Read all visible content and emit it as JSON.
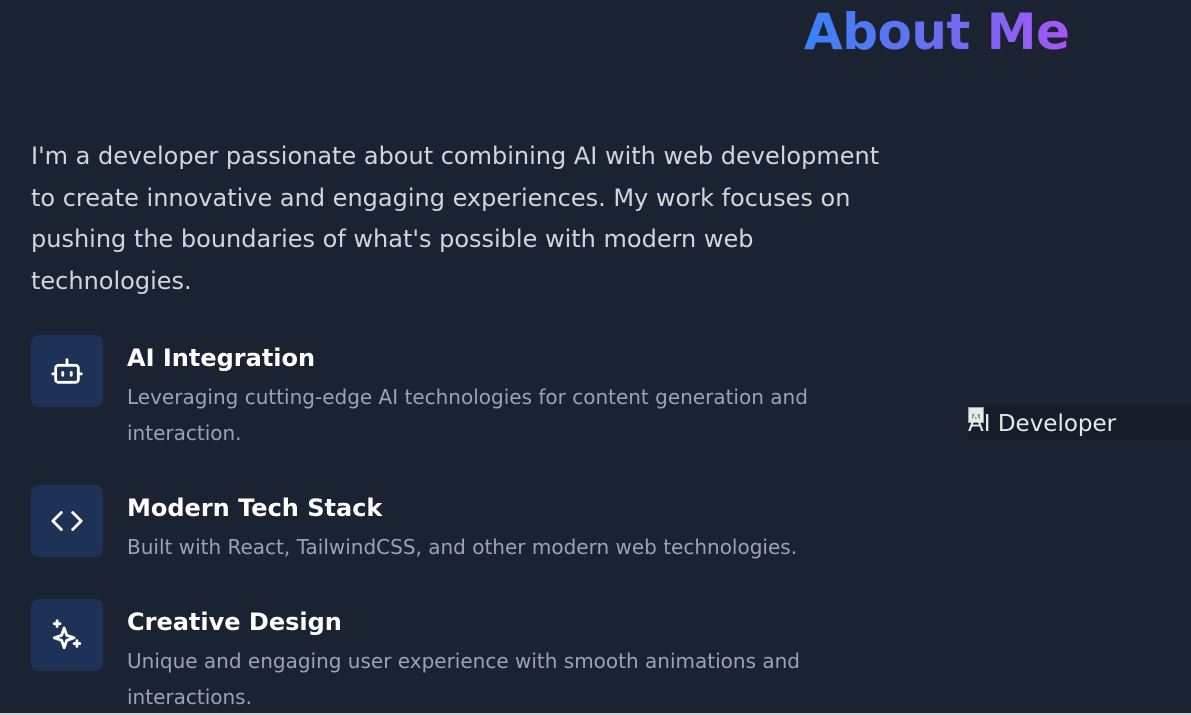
{
  "section": {
    "title": "About Me",
    "intro": "I'm a developer passionate about combining AI with web development to create innovative and engaging experiences. My work focuses on pushing the boundaries of what's possible with modern web technologies."
  },
  "features": [
    {
      "icon": "robot-icon",
      "title": "AI Integration",
      "description": "Leveraging cutting-edge AI technologies for content generation and interaction."
    },
    {
      "icon": "code-icon",
      "title": "Modern Tech Stack",
      "description": "Built with React, TailwindCSS, and other modern web technologies."
    },
    {
      "icon": "sparkles-icon",
      "title": "Creative Design",
      "description": "Unique and engaging user experience with smooth animations and interactions."
    }
  ],
  "image": {
    "alt": "AI Developer"
  },
  "colors": {
    "background": "#1b2333",
    "title_gradient_start": "#3b82f6",
    "title_gradient_end": "#a855f7",
    "icon_tile": "#1e3157",
    "body_text": "#d1d5db",
    "muted_text": "#9ca3af"
  }
}
